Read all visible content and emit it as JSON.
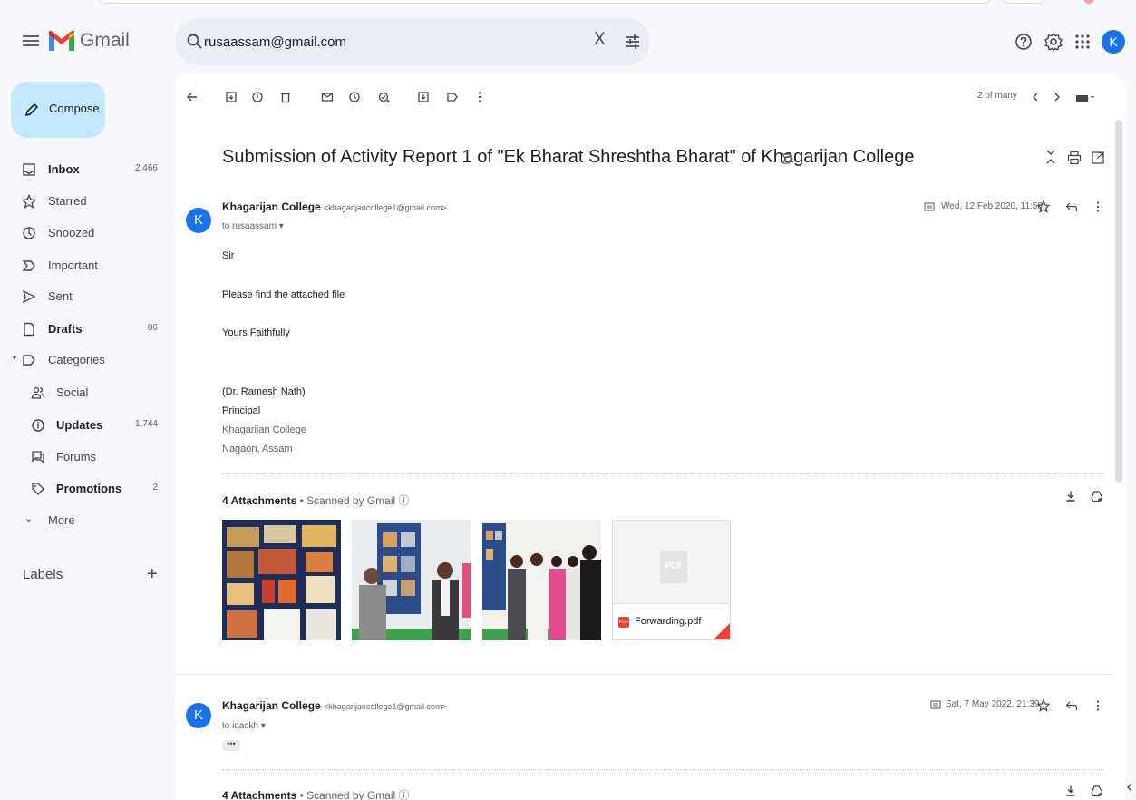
{
  "app": {
    "name": "Gmail"
  },
  "search": {
    "value": "rusaassam@gmail.com",
    "clear_label": "X"
  },
  "header": {
    "avatar_letter": "K"
  },
  "compose": {
    "label": "Compose"
  },
  "sidebar": {
    "items": [
      {
        "label": "Inbox",
        "count": "2,466",
        "bold": true
      },
      {
        "label": "Starred",
        "count": ""
      },
      {
        "label": "Snoozed",
        "count": ""
      },
      {
        "label": "Important",
        "count": ""
      },
      {
        "label": "Sent",
        "count": ""
      },
      {
        "label": "Drafts",
        "count": "86",
        "bold": true
      },
      {
        "label": "Categories",
        "count": ""
      },
      {
        "label": "Social",
        "count": ""
      },
      {
        "label": "Updates",
        "count": "1,744",
        "bold": true
      },
      {
        "label": "Forums",
        "count": ""
      },
      {
        "label": "Promotions",
        "count": "2",
        "bold": true
      },
      {
        "label": "More",
        "count": ""
      }
    ],
    "labels_title": "Labels",
    "labels_add": "+"
  },
  "toolbar": {
    "pager": "2 of many"
  },
  "thread": {
    "subject": "Submission of Activity Report 1 of \"Ek Bharat Shreshtha Bharat\" of Khagarijan College",
    "messages": [
      {
        "avatar": "K",
        "sender": "Khagarijan College",
        "email": "<khagarijancollege1@gmail.com>",
        "to": "to rusaassam ▾",
        "date": "Wed, 12 Feb 2020, 11:58",
        "body": [
          "Sir",
          "Please find the attached file",
          "Yours Faithfully",
          "(Dr. Ramesh Nath)",
          "Principal",
          "Khagarijan College",
          "Nagaon, Assam"
        ],
        "attachments_title": "4 Attachments",
        "scanned": " • Scanned by Gmail ⓘ",
        "pdf_name": "Forwarding.pdf",
        "pdf_icon": "PDF",
        "pdf_badge": "PDF"
      },
      {
        "avatar": "K",
        "sender": "Khagarijan College",
        "email": "<khagarijancollege1@gmail.com>",
        "to": "to iqackh ▾",
        "date": "Sat, 7 May 2022, 21:39",
        "ellipsis": "•••",
        "attachments_title": "4 Attachments",
        "scanned": " • Scanned by Gmail ⓘ"
      }
    ]
  }
}
